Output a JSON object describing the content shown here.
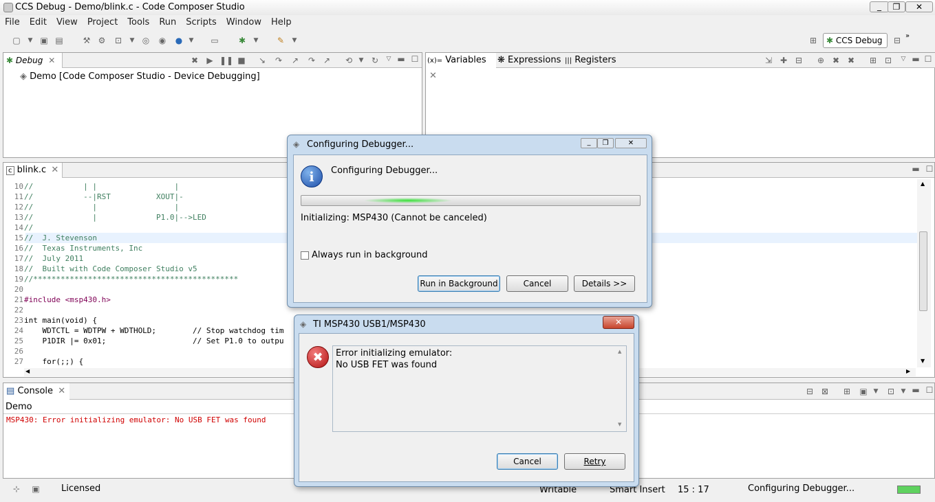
{
  "window": {
    "title": "CCS Debug - Demo/blink.c - Code Composer Studio"
  },
  "menu": [
    "File",
    "Edit",
    "View",
    "Project",
    "Tools",
    "Run",
    "Scripts",
    "Window",
    "Help"
  ],
  "perspective": {
    "label": "CCS Debug"
  },
  "debug_view": {
    "tab": "Debug",
    "item": "Demo [Code Composer Studio - Device Debugging]"
  },
  "variables_view": {
    "tabs": [
      "Variables",
      "Expressions",
      "Registers"
    ]
  },
  "editor": {
    "tab": "blink.c",
    "lines": [
      {
        "n": "10",
        "t": "//           | |                 |"
      },
      {
        "n": "11",
        "t": "//           --|RST          XOUT|-"
      },
      {
        "n": "12",
        "t": "//             |                 |"
      },
      {
        "n": "13",
        "t": "//             |             P1.0|-->LED"
      },
      {
        "n": "14",
        "t": "//"
      },
      {
        "n": "15",
        "t": "//  J. Stevenson"
      },
      {
        "n": "16",
        "t": "//  Texas Instruments, Inc"
      },
      {
        "n": "17",
        "t": "//  July 2011"
      },
      {
        "n": "18",
        "t": "//  Built with Code Composer Studio v5"
      },
      {
        "n": "19",
        "t": "//*********************************************"
      },
      {
        "n": "20",
        "t": ""
      },
      {
        "n": "21",
        "t": "#include <msp430.h>"
      },
      {
        "n": "22",
        "t": ""
      },
      {
        "n": "23",
        "t": "int main(void) {"
      },
      {
        "n": "24",
        "t": "    WDTCTL = WDTPW + WDTHOLD;        // Stop watchdog tim"
      },
      {
        "n": "25",
        "t": "    P1DIR |= 0x01;                   // Set P1.0 to outpu"
      },
      {
        "n": "26",
        "t": ""
      },
      {
        "n": "27",
        "t": "    for(;;) {"
      }
    ]
  },
  "console": {
    "tab": "Console",
    "label": "Demo",
    "message": "MSP430: Error initializing emulator: No USB FET was found"
  },
  "status": {
    "licensed": "Licensed",
    "writable": "Writable",
    "insert": "Smart Insert",
    "position": "15 : 17",
    "job": "Configuring Debugger..."
  },
  "dialog_config": {
    "title": "Configuring Debugger...",
    "heading": "Configuring Debugger...",
    "status": "Initializing: MSP430 (Cannot be canceled)",
    "checkbox": "Always run in background",
    "buttons": {
      "background": "Run in Background",
      "cancel": "Cancel",
      "details": "Details >>"
    }
  },
  "dialog_error": {
    "title": "TI MSP430 USB1/MSP430",
    "line1": "Error initializing emulator:",
    "line2": "No USB FET was found",
    "buttons": {
      "cancel": "Cancel",
      "retry": "Retry"
    }
  },
  "colors": {
    "accent": "#3c7fb1",
    "error": "#d00000",
    "selection": "#e8f2fe"
  }
}
